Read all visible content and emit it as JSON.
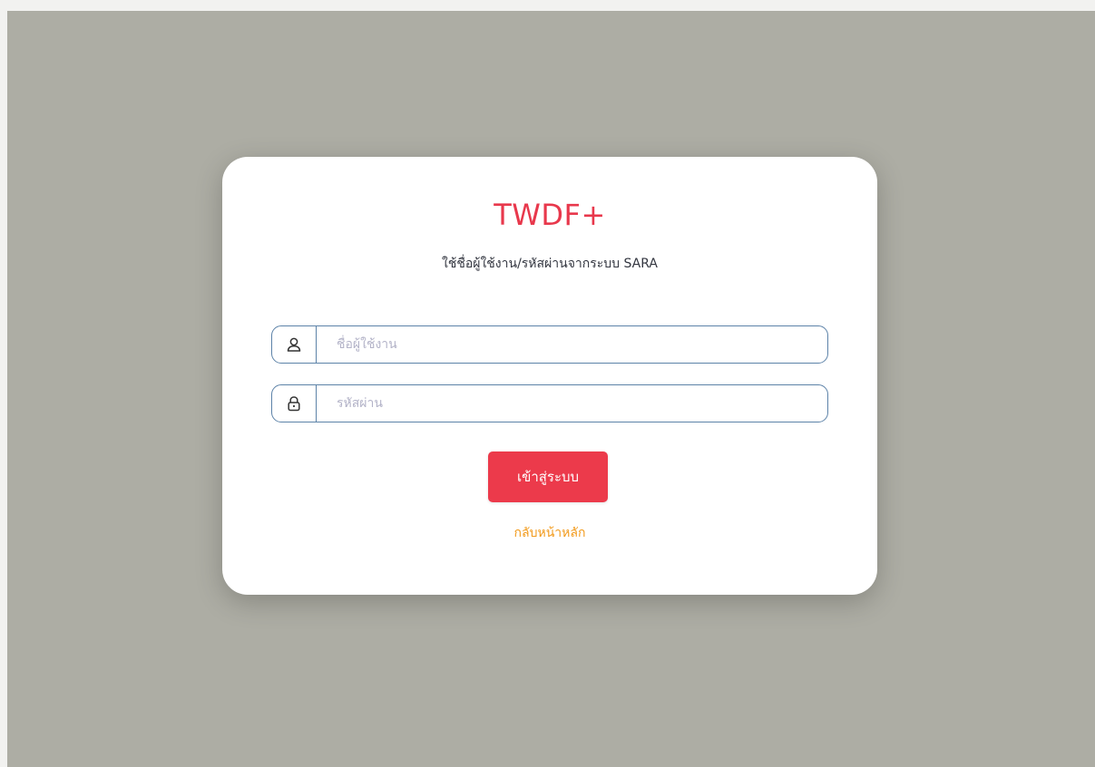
{
  "login": {
    "title": "TWDF+",
    "subtitle": "ใช้ชื่อผู้ใช้งาน/รหัสผ่านจากระบบ SARA",
    "username": {
      "icon": "user-icon",
      "placeholder": "ชื่อผู้ใช้งาน",
      "value": ""
    },
    "password": {
      "icon": "lock-icon",
      "placeholder": "รหัสผ่าน",
      "value": ""
    },
    "submit_label": "เข้าสู่ระบบ",
    "back_link_label": "กลับหน้าหลัก"
  },
  "colors": {
    "page_background": "#adada4",
    "card_background": "#ffffff",
    "title": "#e8384c",
    "button": "#ec3a4b",
    "link": "#f29a1b",
    "field_border": "#5c82a8"
  }
}
